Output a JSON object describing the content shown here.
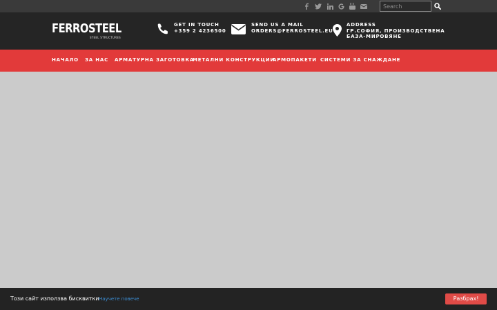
{
  "topbar": {
    "social_icons": [
      "facebook-icon",
      "twitter-icon",
      "linkedin-icon",
      "google-icon",
      "youtube-icon",
      "envelope-icon"
    ],
    "search": {
      "placeholder": "Search",
      "value": ""
    }
  },
  "header": {
    "logo": {
      "name": "FERROSTEEL",
      "tagline": "STEEL STRUCTURES"
    },
    "contacts": [
      {
        "icon": "phone-icon",
        "label": "GET IN TOUCH",
        "value": "+359 2 4236500"
      },
      {
        "icon": "envelope-icon",
        "label": "SEND US A MAIL",
        "value": "ORDERS@FERROSTEEL.EU"
      },
      {
        "icon": "map-marker-icon",
        "label": "ADDRESS",
        "value": "ГР.СОФИЯ, ПРОИЗВОДСТВЕНА",
        "value2": "БАЗА-МИРОВЯНЕ"
      }
    ]
  },
  "nav": {
    "items": [
      {
        "label": "НАЧАЛО"
      },
      {
        "label": "ЗА НАС"
      },
      {
        "label": "АРМАТУРНА ЗАГОТОВКА"
      },
      {
        "label": "МЕТАЛНИ КОНСТРУКЦИИ"
      },
      {
        "label": "АРМОПАКЕТИ"
      },
      {
        "label": "СИСТЕМИ ЗА СНАЖДАНЕ"
      }
    ]
  },
  "cookie": {
    "text": "Този сайт използва бисквитки",
    "link": "Научете повече",
    "button": "Разбрах!"
  },
  "colors": {
    "topbar": "#3a3a3a",
    "header": "#252525",
    "nav": "#e23a3a",
    "content": "#cbcbcb",
    "cookie_bar": "#232323",
    "cookie_button": "#e04b47",
    "link": "#3c8fd6"
  }
}
